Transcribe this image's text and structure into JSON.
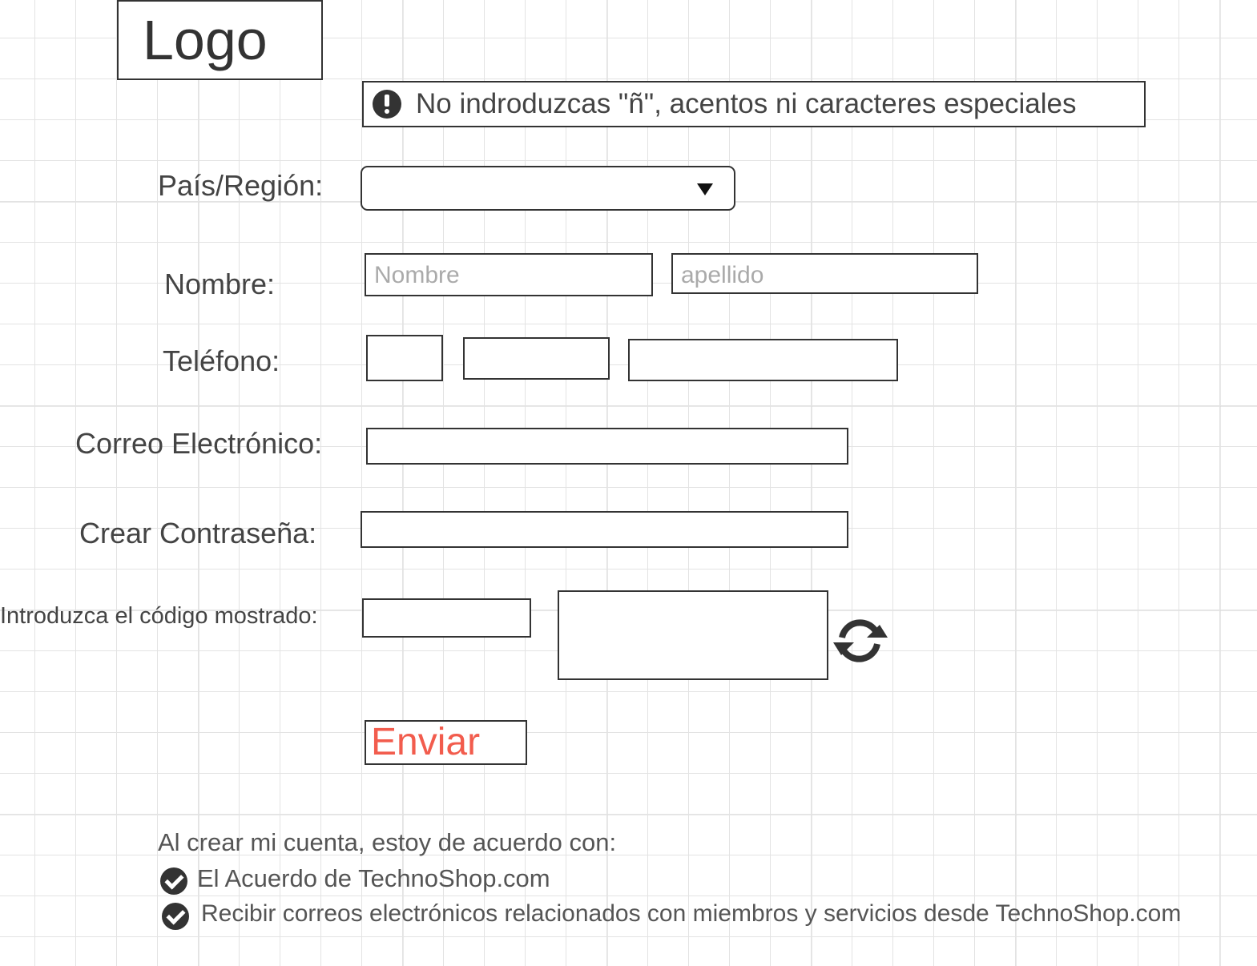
{
  "header": {
    "logo_text": "Logo"
  },
  "notice": {
    "icon": "exclamation-circle-icon",
    "text": "No indroduzcas \"ñ\", acentos ni caracteres especiales"
  },
  "form": {
    "country": {
      "label": "País/Región:",
      "value": "",
      "icon": "dropdown-arrow-icon"
    },
    "name": {
      "label": "Nombre:",
      "first_placeholder": "Nombre",
      "last_placeholder": "apellido"
    },
    "phone": {
      "label": "Teléfono:"
    },
    "email": {
      "label": "Correo Electrónico:"
    },
    "password": {
      "label": "Crear Contraseña:"
    },
    "captcha": {
      "label": "Introduzca el código mostrado:",
      "refresh_icon": "refresh-icon"
    },
    "submit_label": "Enviar"
  },
  "terms": {
    "intro": "Al crear mi cuenta, estoy de acuerdo con:",
    "items": [
      {
        "icon": "check-circle-icon",
        "text": "El Acuerdo de TechnoShop.com"
      },
      {
        "icon": "check-circle-icon",
        "text": "Recibir correos electrónicos relacionados con miembros y servicios desde TechnoShop.com"
      }
    ]
  },
  "colors": {
    "accent": "#f25c4d",
    "border": "#333333",
    "label_text": "#444444",
    "placeholder_text": "#aaaaaa",
    "grid_line": "#e3e3e3"
  }
}
